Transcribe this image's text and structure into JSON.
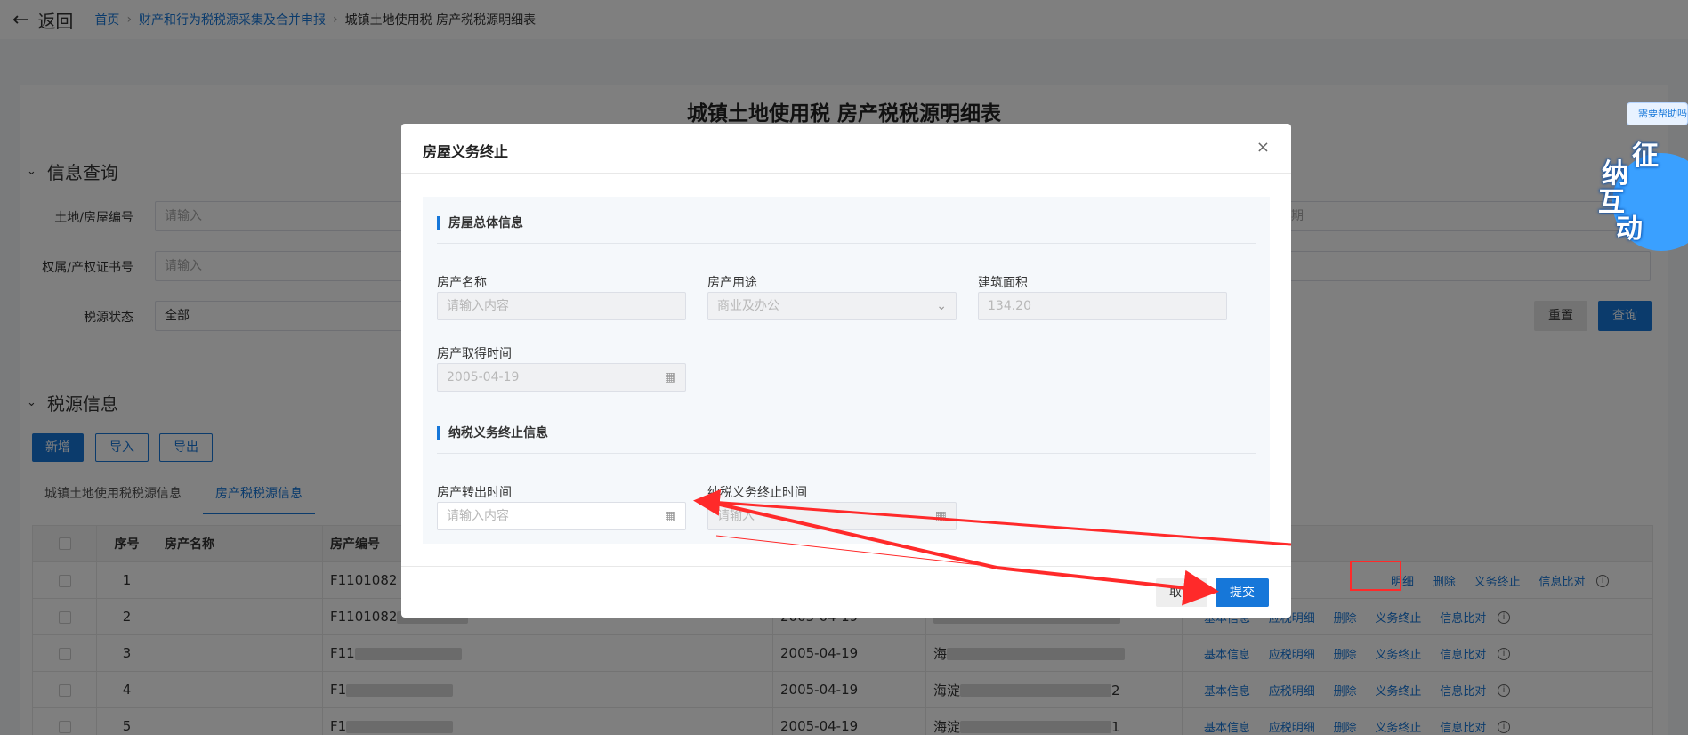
{
  "topbar": {
    "back_label": "返回",
    "breadcrumb": {
      "home": "首页",
      "parent": "财产和行为税税源采集及合并申报",
      "current": "城镇土地使用税 房产税税源明细表"
    }
  },
  "page_title": "城镇土地使用税 房产税税源明细表",
  "query": {
    "heading": "信息查询",
    "land_label": "土地/房屋编号",
    "land_placeholder": "请输入",
    "cert_label": "权属/产权证书号",
    "cert_placeholder": "请输入",
    "status_label": "税源状态",
    "status_value": "全部",
    "date_placeholder_fragment": "期",
    "reset_label": "重置",
    "search_label": "查询"
  },
  "source": {
    "heading": "税源信息",
    "add_label": "新增",
    "import_label": "导入",
    "export_label": "导出",
    "tabs": [
      "城镇土地使用税税源信息",
      "房产税税源信息"
    ],
    "columns": {
      "index": "序号",
      "name": "房产名称",
      "code": "房产编号"
    },
    "rows": [
      {
        "index": "1",
        "code": "F1101082",
        "date": ""
      },
      {
        "index": "2",
        "code": "F1101082",
        "date": "2005-04-19"
      },
      {
        "index": "3",
        "code": "F11",
        "date": "2005-04-19",
        "addr": "海"
      },
      {
        "index": "4",
        "code": "F1",
        "date": "2005-04-19",
        "addr": "海淀",
        "addr_tail": "2"
      },
      {
        "index": "5",
        "code": "F1",
        "date": "2005-04-19",
        "addr": "海淀",
        "addr_tail": "1"
      }
    ],
    "ops": {
      "basic": "基本信息",
      "detail": "应税明细",
      "detail_fragment": "明细",
      "delete": "删除",
      "terminate": "义务终止",
      "compare": "信息比对"
    }
  },
  "help": {
    "badge": "需要帮助吗",
    "mascot_chars": [
      "征",
      "纳",
      "互",
      "动"
    ]
  },
  "modal": {
    "title": "房屋义务终止",
    "close": "×",
    "section1": "房屋总体信息",
    "name_label": "房产名称",
    "name_placeholder": "请输入内容",
    "use_label": "房产用途",
    "use_value": "商业及办公",
    "area_label": "建筑面积",
    "area_value": "134.20",
    "acquire_label": "房产取得时间",
    "acquire_value": "2005-04-19",
    "section2": "纳税义务终止信息",
    "transfer_label": "房产转出时间",
    "transfer_placeholder": "请输入内容",
    "end_label": "纳税义务终止时间",
    "end_placeholder": "请输入",
    "cancel_label": "取消",
    "submit_label": "提交"
  },
  "colors": {
    "primary": "#1677d9",
    "annotation": "#ff2a2a"
  }
}
